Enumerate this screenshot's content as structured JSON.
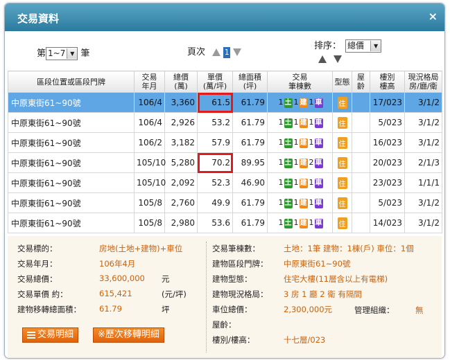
{
  "window": {
    "title": "交易資料",
    "close_label": "×"
  },
  "controls": {
    "records_prefix": "第",
    "records_range": "1~7",
    "records_suffix": "筆",
    "page_label": "頁次",
    "page_current": "1",
    "sort_label": "排序：",
    "sort_value": "總價"
  },
  "table": {
    "headers": [
      "區段位置或區段門牌",
      "交易\n年月",
      "總價\n(萬)",
      "單價\n(萬/坪)",
      "總面積\n(坪)",
      "交易\n筆棟數",
      "型態",
      "屋\n齡",
      "樓別\n樓高",
      "現況格局\n房/廳/衛"
    ],
    "rows": [
      {
        "addr": "中原東街61~90號",
        "date": "106/4",
        "total": "3,360",
        "unit": "61.5",
        "area": "61.79",
        "land": "1",
        "bldg": "1",
        "park": "1",
        "type": "住",
        "age": "",
        "floor": "17/023",
        "layout": "3/1/2",
        "land_t": "土",
        "bldg_t": "建",
        "park_t": "車"
      },
      {
        "addr": "中原東街61~90號",
        "date": "106/4",
        "total": "2,926",
        "unit": "53.2",
        "area": "61.79",
        "land": "1",
        "bldg": "1",
        "park": "1",
        "type": "住",
        "age": "",
        "floor": "5/023",
        "layout": "3/1/2",
        "land_t": "土",
        "bldg_t": "建",
        "park_t": "車"
      },
      {
        "addr": "中原東街61~90號",
        "date": "106/2",
        "total": "3,182",
        "unit": "57.9",
        "area": "61.79",
        "land": "1",
        "bldg": "1",
        "park": "1",
        "type": "住",
        "age": "",
        "floor": "16/023",
        "layout": "3/1/2",
        "land_t": "土",
        "bldg_t": "建",
        "park_t": "車"
      },
      {
        "addr": "中原東街61~90號",
        "date": "105/10",
        "total": "5,280",
        "unit": "70.2",
        "area": "89.95",
        "land": "1",
        "bldg": "1",
        "park": "2",
        "type": "住",
        "age": "",
        "floor": "20/023",
        "layout": "2/1/3",
        "land_t": "土",
        "bldg_t": "建",
        "park_t": "車"
      },
      {
        "addr": "中原東街61~90號",
        "date": "105/10",
        "total": "2,092",
        "unit": "52.3",
        "area": "46.90",
        "land": "1",
        "bldg": "1",
        "park": "1",
        "type": "住",
        "age": "",
        "floor": "23/023",
        "layout": "1/1/1",
        "land_t": "土",
        "bldg_t": "建",
        "park_t": "車"
      },
      {
        "addr": "中原東街61~90號",
        "date": "105/8",
        "total": "2,760",
        "unit": "49.9",
        "area": "61.79",
        "land": "1",
        "bldg": "1",
        "park": "1",
        "type": "住",
        "age": "",
        "floor": "5/023",
        "layout": "3/1/2",
        "land_t": "土",
        "bldg_t": "建",
        "park_t": "車"
      },
      {
        "addr": "中原東街61~90號",
        "date": "105/8",
        "total": "2,980",
        "unit": "53.6",
        "area": "61.79",
        "land": "1",
        "bldg": "1",
        "park": "1",
        "type": "住",
        "age": "",
        "floor": "14/023",
        "layout": "3/1/2",
        "land_t": "土",
        "bldg_t": "建",
        "park_t": "車"
      }
    ]
  },
  "detail": {
    "left": [
      {
        "label": "交易標的：",
        "value": "房地(土地+建物)+車位",
        "unit": ""
      },
      {
        "label": "交易年月：",
        "value": "106年4月",
        "unit": ""
      },
      {
        "label": "交易總價：",
        "value": "33,600,000",
        "unit": "元"
      },
      {
        "label": "交易單價 約：",
        "value": "615,421",
        "unit": "(元/坪)"
      },
      {
        "label": "建物移轉總面積：",
        "value": "61.79",
        "unit": "坪"
      }
    ],
    "right": [
      {
        "label": "交易筆棟數：",
        "value": "土地：1筆 建物：1棟(戶) 車位：1個"
      },
      {
        "label": "建物區段門牌：",
        "value": "中原東街61~90號"
      },
      {
        "label": "建物型態：",
        "value": "住宅大樓(11層含以上有電梯)"
      },
      {
        "label": "建物現況格局：",
        "value": "3 房 1 廳 2 衛 有隔間"
      },
      {
        "label": "車位總價：",
        "value": "2,300,000元"
      },
      {
        "label": "屋齡：",
        "value": ""
      },
      {
        "label": "樓別/樓高：",
        "value": "十七層/023"
      }
    ],
    "mgmt_label": "管理組織：",
    "mgmt_value": "無",
    "btn_detail": "交易明細",
    "btn_history": "※歷次移轉明細"
  }
}
